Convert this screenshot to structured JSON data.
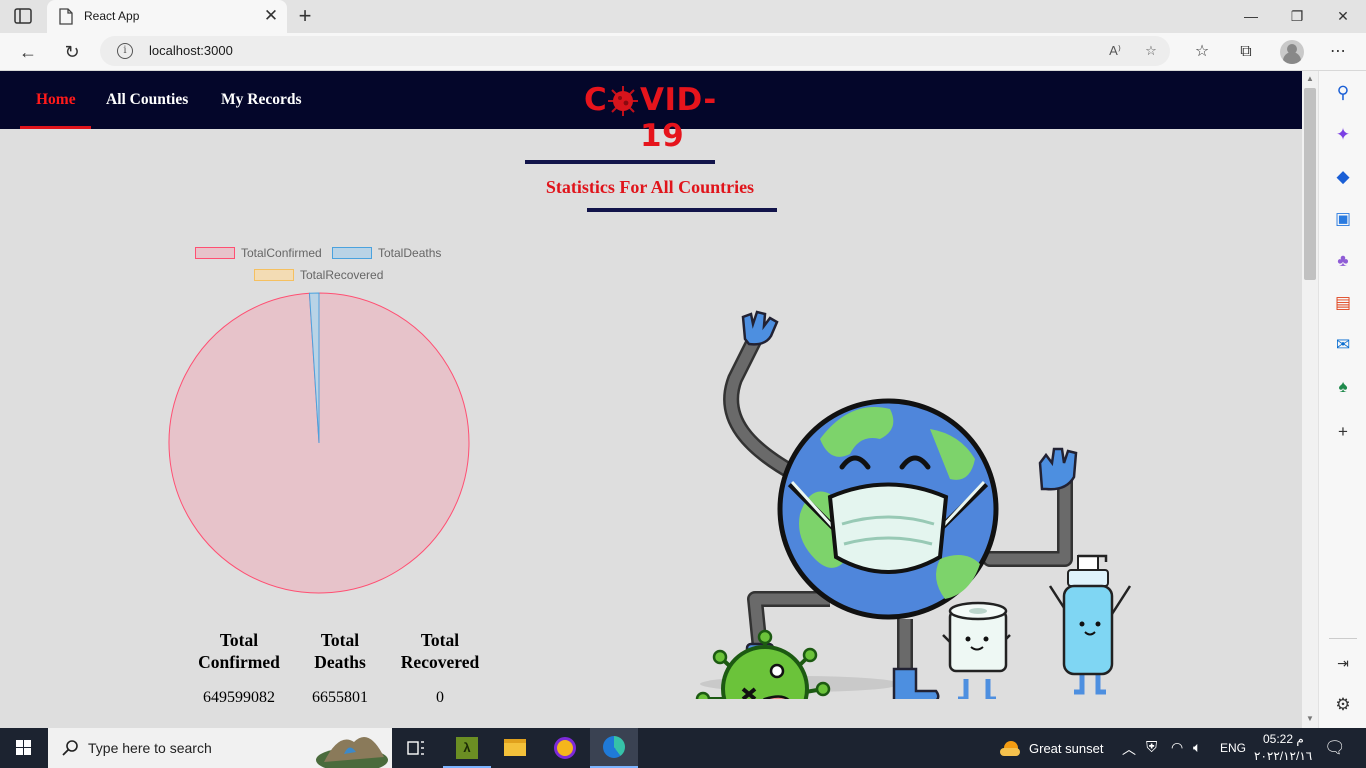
{
  "browser": {
    "tab_title": "React App",
    "url": "localhost:3000"
  },
  "navbar": {
    "links": [
      "Home",
      "All Counties",
      "My Records"
    ],
    "brand_left": "C",
    "brand_right": "VID-19"
  },
  "section": {
    "title": "Statistics For All Countries"
  },
  "chart_data": {
    "type": "pie",
    "title": "",
    "labels": [
      "TotalConfirmed",
      "TotalDeaths",
      "TotalRecovered"
    ],
    "values": [
      649599082,
      6655801,
      0
    ],
    "colors": [
      "#e7c3ca",
      "#b9d3e6",
      "#f3dcb4"
    ],
    "border_colors": [
      "#ff4f72",
      "#4aa2de",
      "#f5c060"
    ],
    "legend_position": "top"
  },
  "stats": {
    "headers": [
      [
        "Total",
        "Confirmed"
      ],
      [
        "Total",
        "Deaths"
      ],
      [
        "Total",
        "Recovered"
      ]
    ],
    "values": [
      "649599082",
      "6655801",
      "0"
    ]
  },
  "taskbar": {
    "search_placeholder": "Type here to search",
    "weather": "Great sunset",
    "language": "ENG",
    "time": "05:22 م",
    "date": "٢٠٢٢/١٢/١٦"
  }
}
